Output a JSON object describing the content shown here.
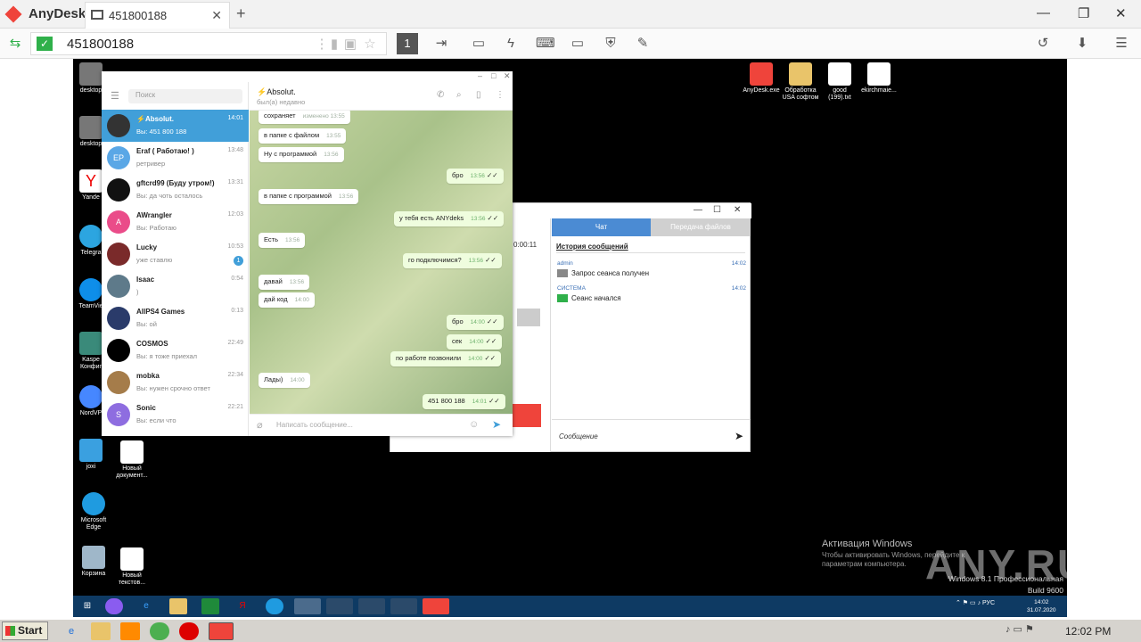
{
  "anydesk": {
    "app_title": "AnyDesk",
    "tab_label": "451800188",
    "address_value": "451800188",
    "toolbar_number": "1",
    "brand_color": "#ef443b"
  },
  "desktop_icons": {
    "left": [
      {
        "label": "desktop",
        "icon": "desktop-file-icon"
      },
      {
        "label": "desktop",
        "icon": "desktop-file-icon"
      },
      {
        "label": "Yande",
        "icon": "yandex-icon"
      },
      {
        "label": "Telegra",
        "icon": "telegram-icon"
      },
      {
        "label": "TeamVie",
        "icon": "teamviewer-icon"
      },
      {
        "label": "Kaspe\nКонфиг",
        "icon": "kaspersky-icon"
      },
      {
        "label": "NordVP",
        "icon": "nordvpn-icon"
      },
      {
        "label": "joxi",
        "icon": "joxi-icon"
      },
      {
        "label": "Microsoft\nEdge",
        "icon": "edge-icon"
      },
      {
        "label": "Корзина",
        "icon": "recycle-bin-icon"
      }
    ],
    "middle": [
      {
        "label": "Новый\nдокумент...",
        "icon": "document-icon"
      },
      {
        "label": "Новый\nтекстов...",
        "icon": "text-file-icon"
      }
    ],
    "top_right": [
      {
        "label": "AnyDesk.exe",
        "icon": "anydesk-icon"
      },
      {
        "label": "Обработка\nUSA софтом",
        "icon": "folder-icon"
      },
      {
        "label": "good\n(199).txt",
        "icon": "text-file-icon"
      },
      {
        "label": "ekirchmaie...",
        "icon": "text-file-icon"
      }
    ]
  },
  "telegram": {
    "search_placeholder": "Поиск",
    "header_title": "⚡Absolut.",
    "header_status": "был(а) недавно",
    "input_placeholder": "Написать сообщение...",
    "chats": [
      {
        "name": "⚡Absolut.",
        "preview": "Вы: 451 800 188",
        "time": "14:01",
        "avatar_color": "#333333",
        "initials": ""
      },
      {
        "name": "Eraf ( Работаю! )",
        "preview": "ретривер",
        "time": "13:48",
        "avatar_color": "#5aa7e6",
        "initials": "EP"
      },
      {
        "name": "gftcrd99 (Буду утром!)",
        "preview": "Вы: да чоть осталось",
        "time": "13:31",
        "avatar_color": "#111111",
        "initials": ""
      },
      {
        "name": "AWrangler",
        "preview": "Вы: Работаю",
        "time": "12:03",
        "avatar_color": "#ea4c89",
        "initials": "A"
      },
      {
        "name": "Lucky",
        "preview": "уже ставлю",
        "time": "10:53",
        "avatar_color": "#7a2a2a",
        "initials": "",
        "badge": "1"
      },
      {
        "name": "Isaac",
        "preview": ")",
        "time": "0:54",
        "avatar_color": "#5e7a8a",
        "initials": ""
      },
      {
        "name": "AllPS4 Games",
        "preview": "Вы: ой",
        "time": "0:13",
        "avatar_color": "#2a3b6a",
        "initials": ""
      },
      {
        "name": "COSMOS",
        "preview": "Вы: я тоже приехал",
        "time": "22:49",
        "avatar_color": "#000000",
        "initials": ""
      },
      {
        "name": "mobka",
        "preview": "Вы: нужен срочно ответ",
        "time": "22:34",
        "avatar_color": "#a57c4a",
        "initials": ""
      },
      {
        "name": "Sonic",
        "preview": "Вы: если что",
        "time": "22:21",
        "avatar_color": "#8e6de0",
        "initials": "S"
      }
    ],
    "messages": [
      {
        "text": "сохраняет",
        "time": "изменено 13:55",
        "out": false
      },
      {
        "text": "в папке с файлом",
        "time": "13:55",
        "out": false
      },
      {
        "text": "Ну с программой",
        "time": "13:56",
        "out": false
      },
      {
        "text": "бро",
        "time": "13:56",
        "out": true
      },
      {
        "text": "в папке с программой",
        "time": "13:56",
        "out": false
      },
      {
        "text": "у тебя есть ANYdeks",
        "time": "13:56",
        "out": true
      },
      {
        "text": "Есть",
        "time": "13:56",
        "out": false
      },
      {
        "text": "го подключимся?",
        "time": "13:56",
        "out": true
      },
      {
        "text": "давай",
        "time": "13:56",
        "out": false
      },
      {
        "text": "дай код",
        "time": "14:00",
        "out": false
      },
      {
        "text": "бро",
        "time": "14:00",
        "out": true
      },
      {
        "text": "сек",
        "time": "14:00",
        "out": true
      },
      {
        "text": "по работе позвонили",
        "time": "14:00",
        "out": true
      },
      {
        "text": "Лады)",
        "time": "14:00",
        "out": false
      },
      {
        "text": "451 800 188",
        "time": "14:01",
        "out": true
      }
    ]
  },
  "anydesk_session": {
    "timer": "0:00:11",
    "tab_chat": "Чат",
    "tab_files": "Передача файлов",
    "history_title": "История сообщений",
    "entries": [
      {
        "who": "admin",
        "time": "14:02",
        "text": "Запрос сеанса получен"
      },
      {
        "who": "СИСТЕМА",
        "time": "14:02",
        "text": "Сеанс начался"
      }
    ],
    "message_placeholder": "Сообщение"
  },
  "activation": {
    "title": "Активация Windows",
    "text": "Чтобы активировать Windows, перейдите к параметрам компьютера.",
    "watermark": "ANY.RUN",
    "build_line1": "Windows 8.1 Профессиональная",
    "build_line2": "Build 9600"
  },
  "remote_taskbar": {
    "lang": "РУС",
    "clock_time": "14:02",
    "clock_date": "31.07.2020"
  },
  "local_taskbar": {
    "start_label": "Start",
    "clock": "12:02 PM"
  }
}
